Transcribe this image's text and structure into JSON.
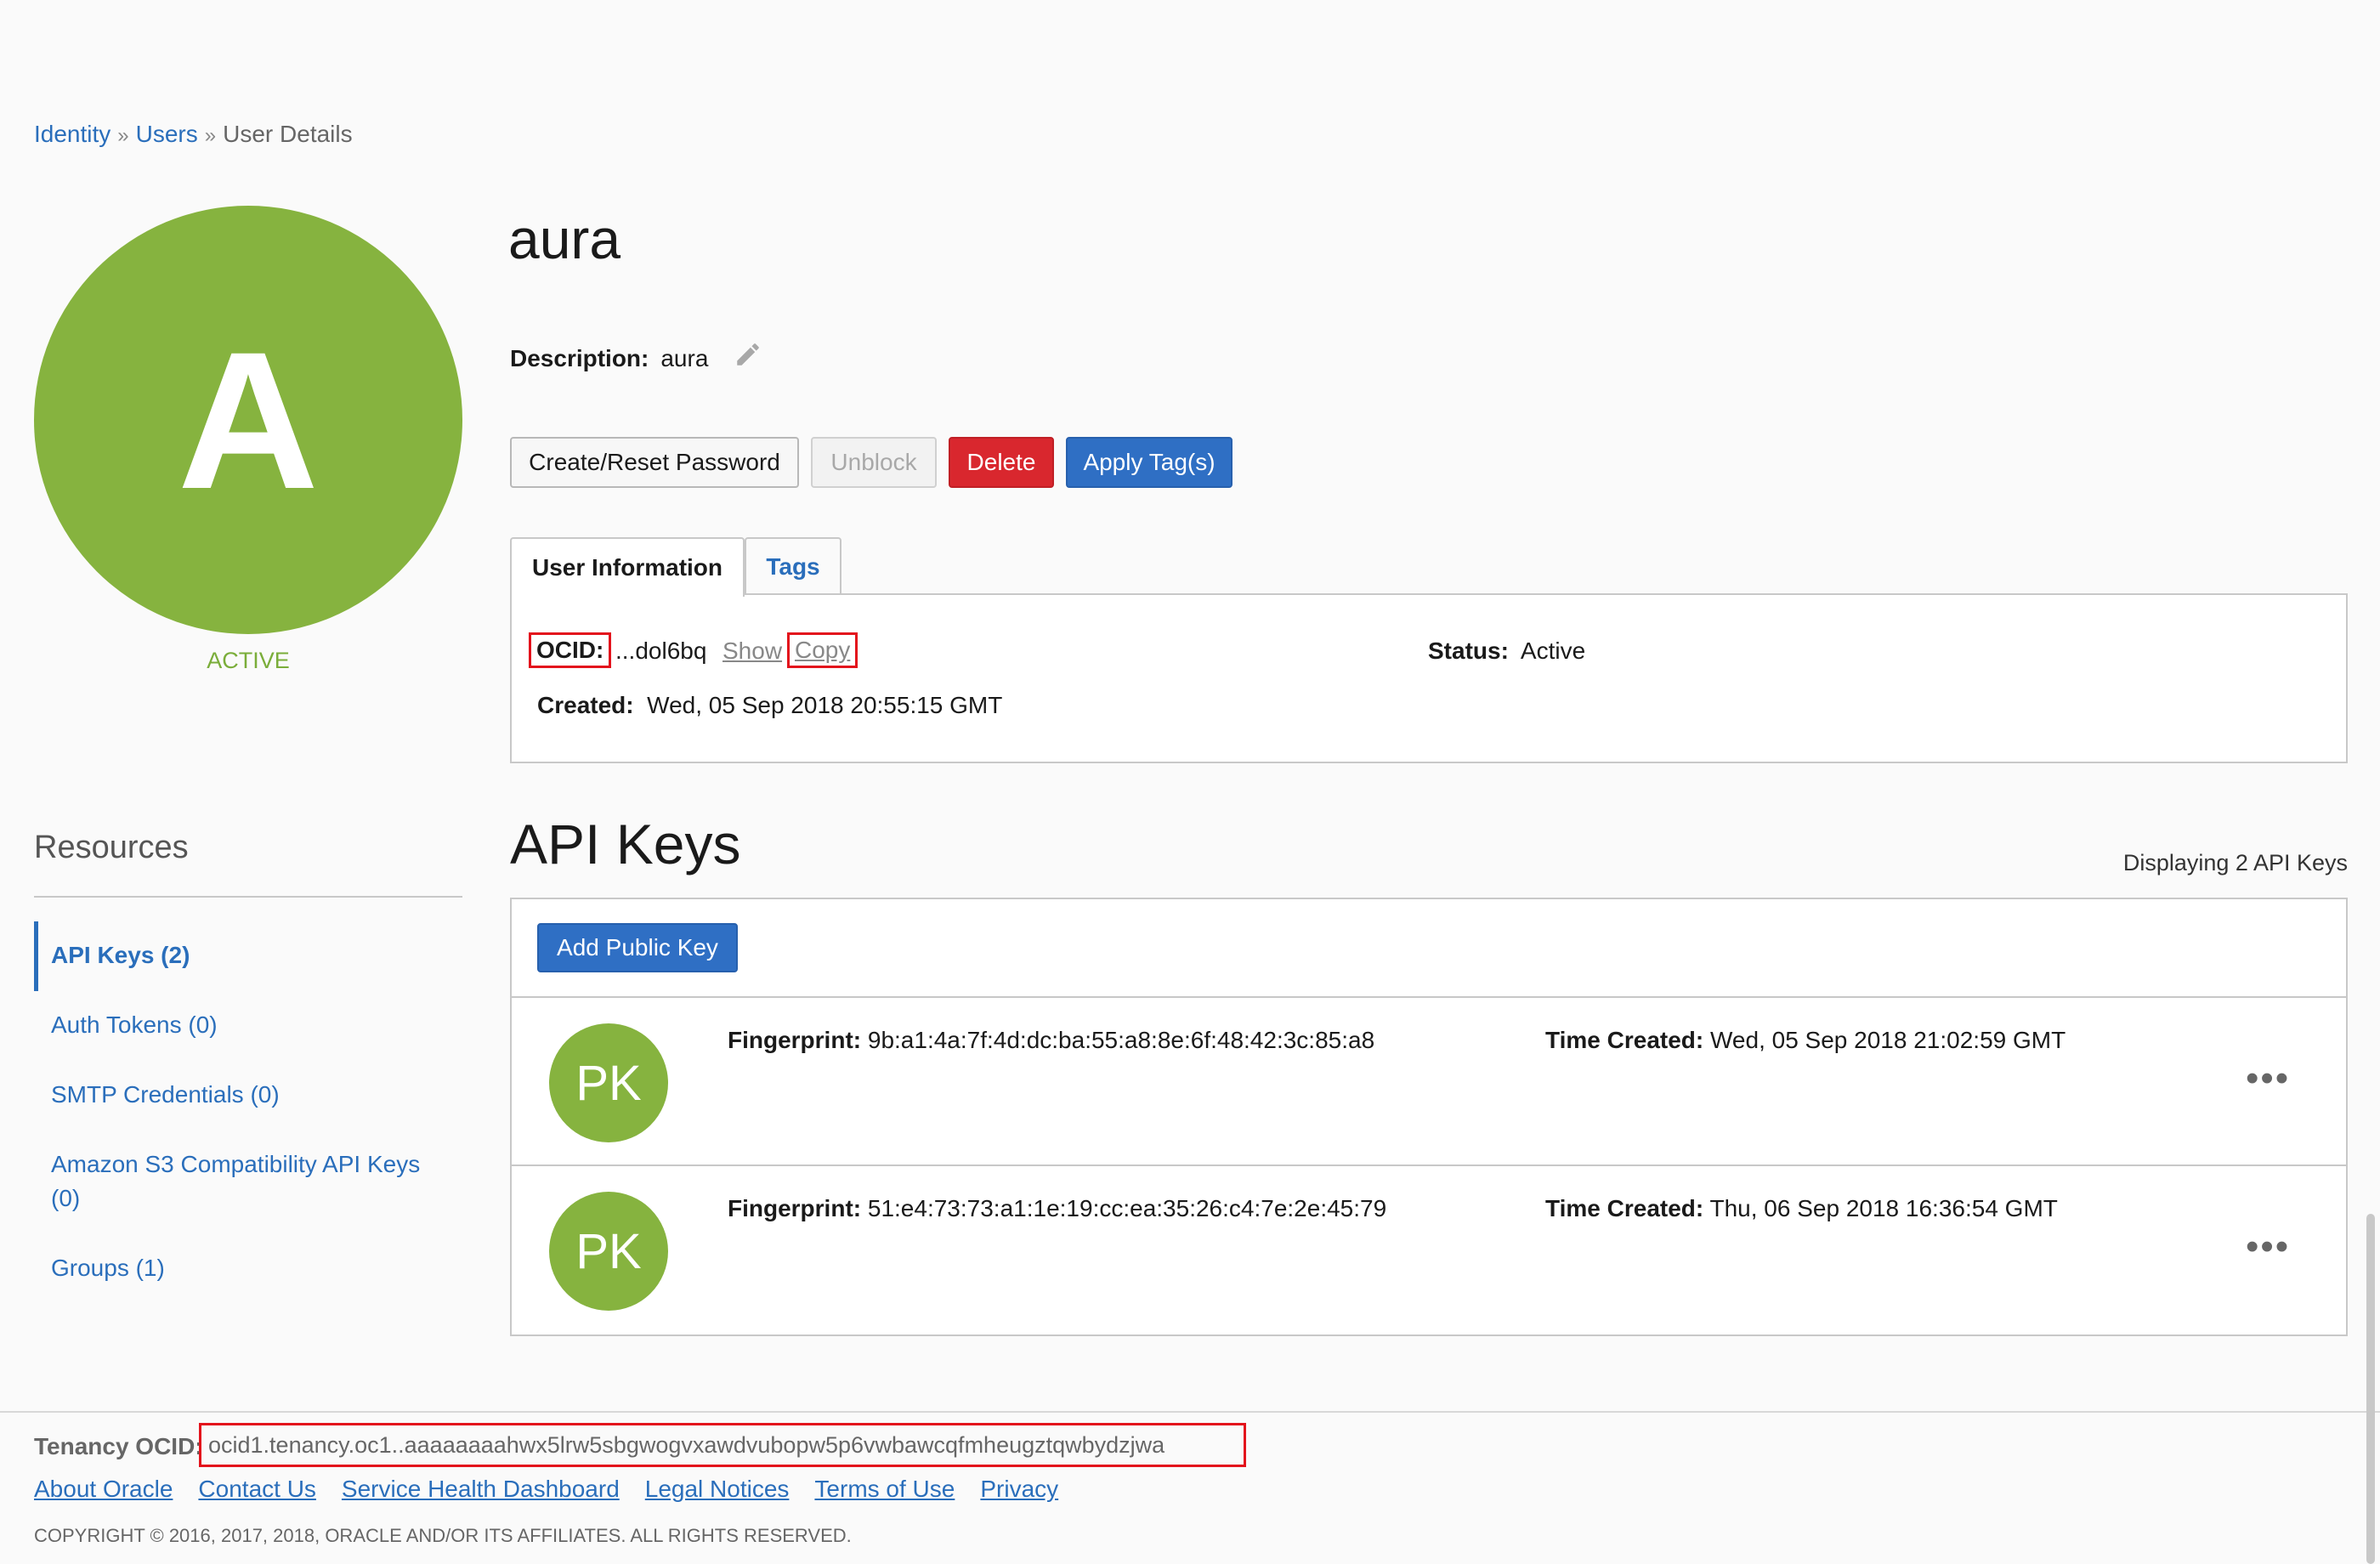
{
  "breadcrumb": {
    "items": [
      "Identity",
      "Users",
      "User Details"
    ],
    "separator": "»"
  },
  "user": {
    "avatar_letter": "A",
    "status_label": "ACTIVE",
    "name": "aura",
    "description_label": "Description:",
    "description_value": "aura"
  },
  "actions": {
    "reset_password": "Create/Reset Password",
    "unblock": "Unblock",
    "delete": "Delete",
    "apply_tags": "Apply Tag(s)"
  },
  "tabs": {
    "user_info": "User Information",
    "tags": "Tags"
  },
  "info": {
    "ocid_label": "OCID:",
    "ocid_value": "...dol6bq",
    "show": "Show",
    "copy": "Copy",
    "status_label": "Status:",
    "status_value": "Active",
    "created_label": "Created:",
    "created_value": "Wed, 05 Sep 2018 20:55:15 GMT"
  },
  "resources": {
    "title": "Resources",
    "items": [
      "API Keys (2)",
      "Auth Tokens (0)",
      "SMTP Credentials (0)",
      "Amazon S3 Compatibility API Keys",
      "(0)",
      "Groups (1)"
    ]
  },
  "api_keys": {
    "title": "API Keys",
    "displaying": "Displaying 2 API Keys",
    "add_button": "Add Public Key",
    "fingerprint_label": "Fingerprint:",
    "time_label": "Time Created:",
    "rows": [
      {
        "avatar": "PK",
        "fingerprint": "9b:a1:4a:7f:4d:dc:ba:55:a8:8e:6f:48:42:3c:85:a8",
        "time_created": "Wed, 05 Sep 2018 21:02:59 GMT",
        "menu": "•••"
      },
      {
        "avatar": "PK",
        "fingerprint": "51:e4:73:73:a1:1e:19:cc:ea:35:26:c4:7e:2e:45:79",
        "time_created": "Thu, 06 Sep 2018 16:36:54 GMT",
        "menu": "•••"
      }
    ]
  },
  "footer": {
    "tenancy_label": "Tenancy OCID:",
    "tenancy_value": "ocid1.tenancy.oc1..aaaaaaaahwx5lrw5sbgwogvxawdvubopw5p6vwbawcqfmheugztqwbydzjwa",
    "links": [
      "About Oracle",
      "Contact Us",
      "Service Health Dashboard",
      "Legal Notices",
      "Terms of Use",
      "Privacy"
    ],
    "copyright": "COPYRIGHT © 2016, 2017, 2018, ORACLE AND/OR ITS AFFILIATES. ALL RIGHTS RESERVED."
  },
  "colors": {
    "brand_green": "#86b33f",
    "link_blue": "#2a6ebb",
    "primary_button": "#2f6fc4",
    "danger_button": "#d9272e",
    "highlight_red": "#e3121c"
  }
}
